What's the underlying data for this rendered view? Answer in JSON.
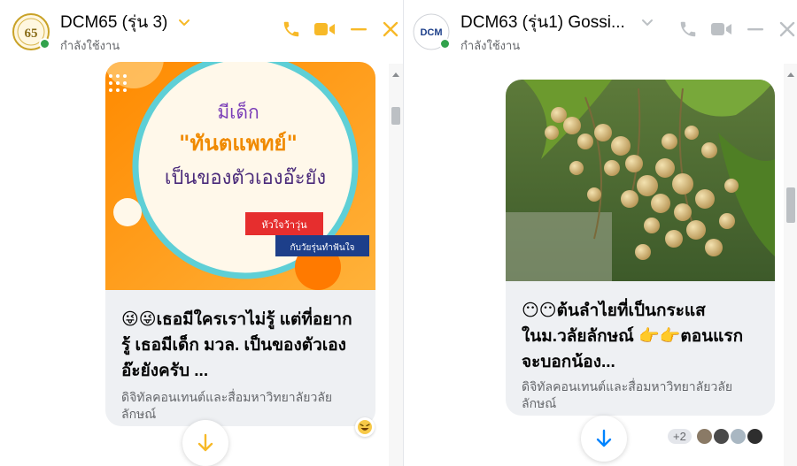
{
  "left_chat": {
    "title": "DCM65 (รุ่น 3)",
    "status": "กำลังใช้งาน",
    "avatar_text": "65",
    "accent_color": "#f7b928",
    "card": {
      "image": {
        "headline_1": "มีเด็ก",
        "headline_2": "\"ทันตแพทย์\"",
        "headline_3": "เป็นของตัวเองอ๊ะยัง",
        "tag_red": "หัวใจว้าวุ่น",
        "tag_dark": "กับวัยรุ่นทำฟันใจ"
      },
      "title": "😜😜เธอมีใครเราไม่รู้ แต่ที่อยากรู้ เธอมีเด็ก มวล. เป็นของตัวเองอ๊ะยังครับ ...",
      "subtitle": "ดิจิทัลคอนเทนต์และสื่อมหาวิทยาลัยวลัยลักษณ์"
    },
    "reaction_icon": "laughing-emoji-icon"
  },
  "right_chat": {
    "title": "DCM63 (รุ่น1) Gossi...",
    "status": "กำลังใช้งาน",
    "avatar_text": "DCM",
    "card": {
      "title": "😶😶ต้นลำไยที่เป็นกระแสในม.วลัยลักษณ์ 👉👉ตอนแรกจะบอกน้อง...",
      "subtitle": "ดิจิทัลคอนเทนต์และสื่อมหาวิทยาลัยวลัยลักษณ์"
    },
    "seen_count": "+2",
    "accent_color": "#bcc0c4"
  },
  "colors": {
    "brand_blue": "#0084ff",
    "accent_yellow": "#f7b928",
    "online_green": "#31a24c"
  }
}
